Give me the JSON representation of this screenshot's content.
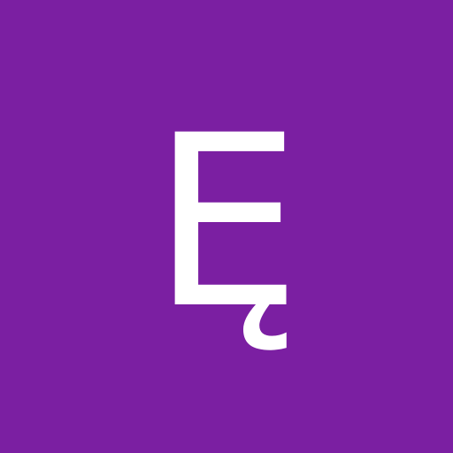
{
  "avatar": {
    "letter": "Ę",
    "background_color": "#7b1fa2",
    "text_color": "#ffffff"
  }
}
